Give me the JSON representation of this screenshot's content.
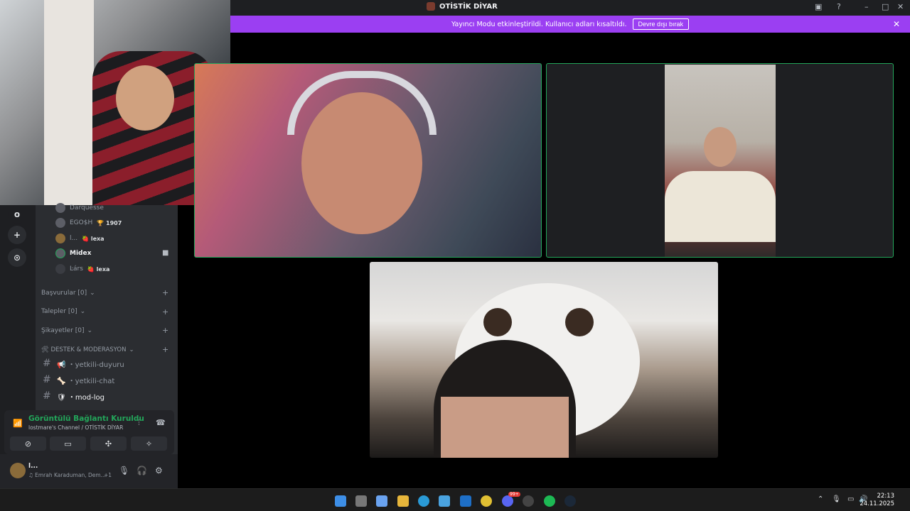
{
  "window": {
    "title": "OTİSTİK DİYAR"
  },
  "banner": {
    "message": "Yayıncı Modu etkinleştirildi. Kullanıcı adları kısaltıldı.",
    "button_label": "Devre dışı bırak"
  },
  "guilds": [
    {
      "label": "o"
    },
    {
      "label": "+"
    },
    {
      "label": "⊙"
    }
  ],
  "members": [
    {
      "name": "Darquesse",
      "badge": ""
    },
    {
      "name": "EGO$H",
      "badge": "🏆 1907"
    },
    {
      "name": "l...",
      "badge": "🍓 lexa"
    },
    {
      "name": "Midex",
      "badge": ""
    },
    {
      "name": "Ŀárs",
      "badge": "🍓 lexa"
    }
  ],
  "categories": [
    {
      "label": "Başvurular [0]"
    },
    {
      "label": "Talepler [0]"
    },
    {
      "label": "Şikayetler [0]"
    },
    {
      "label": "🛠 DESTEK & MODERASYON"
    }
  ],
  "channels": [
    {
      "label": "📢 ・yetkili-duyuru"
    },
    {
      "label": "🦴 ・yetkili-chat"
    },
    {
      "label": "🛡 ・mod-log"
    }
  ],
  "voice": {
    "status": "Görüntülü Bağlantı Kuruldu",
    "channel": "lostmare's Channel / OTİSTİK DİYAR"
  },
  "user": {
    "name": "l...",
    "activity": "♫ Emrah Karaduman, Dem...",
    "extra": "+1"
  },
  "taskbar": {
    "time": "22:13",
    "date": "24.11.2025",
    "badge": "99+"
  }
}
